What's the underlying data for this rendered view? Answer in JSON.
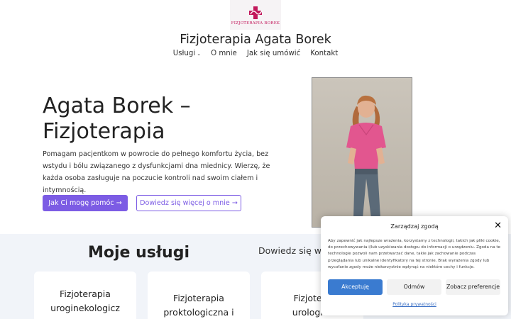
{
  "header": {
    "logo_text": "FIZJOTERAPIA BOREK",
    "site_title": "Fizjoterapia Agata Borek",
    "logo_color": "#c2185b"
  },
  "nav": {
    "items": [
      {
        "label": "Usługi",
        "has_dropdown": true
      },
      {
        "label": "O mnie"
      },
      {
        "label": "Jak się umówić"
      },
      {
        "label": "Kontakt"
      }
    ],
    "chevron_icon": "chevron-down-icon"
  },
  "hero": {
    "title_line1": "Agata Borek –",
    "title_line2": "Fizjoterapia",
    "description": "Pomagam pacjentkom w powrocie do pełnego komfortu życia, bez wstydu i bólu związanego z dysfunkcjami dna miednicy. Wierzę, że każda osoba zasługuje na poczucie kontroli nad swoim ciałem i intymnością.",
    "primary_button": "Jak Ci mogę pomóc →",
    "secondary_button": "Dowiedz się więcej o mnie →",
    "accent_color": "#7c5ce4"
  },
  "services": {
    "title": "Moje usługi",
    "learn_more": "Dowiedz się w j",
    "cards": [
      {
        "title_line1": "Fizjoterapia",
        "title_line2": "uroginekologicz"
      },
      {
        "title_line1": "Fizjoterapia",
        "title_line2": "proktologiczna i"
      },
      {
        "title_line1": "Fizjotera",
        "title_line2": "urologicz"
      }
    ]
  },
  "consent": {
    "title": "Zarządzaj zgodą",
    "text": "Aby zapewnić jak najlepsze wrażenia, korzystamy z technologii, takich jak pliki cookie, do przechowywania i/lub uzyskiwania dostępu do informacji o urządzeniu. Zgoda na te technologie pozwoli nam przetwarzać dane, takie jak zachowanie podczas przeglądania lub unikalne identyfikatory na tej stronie. Brak wyrażenia zgody lub wycofanie zgody może niekorzystnie wpłynąć na niektóre cechy i funkcje.",
    "accept": "Akceptuję",
    "deny": "Odmów",
    "preferences": "Zobacz preferencje",
    "privacy_link": "Polityka prywatności",
    "close_icon": "close-icon",
    "accept_color": "#3a7bd0"
  }
}
